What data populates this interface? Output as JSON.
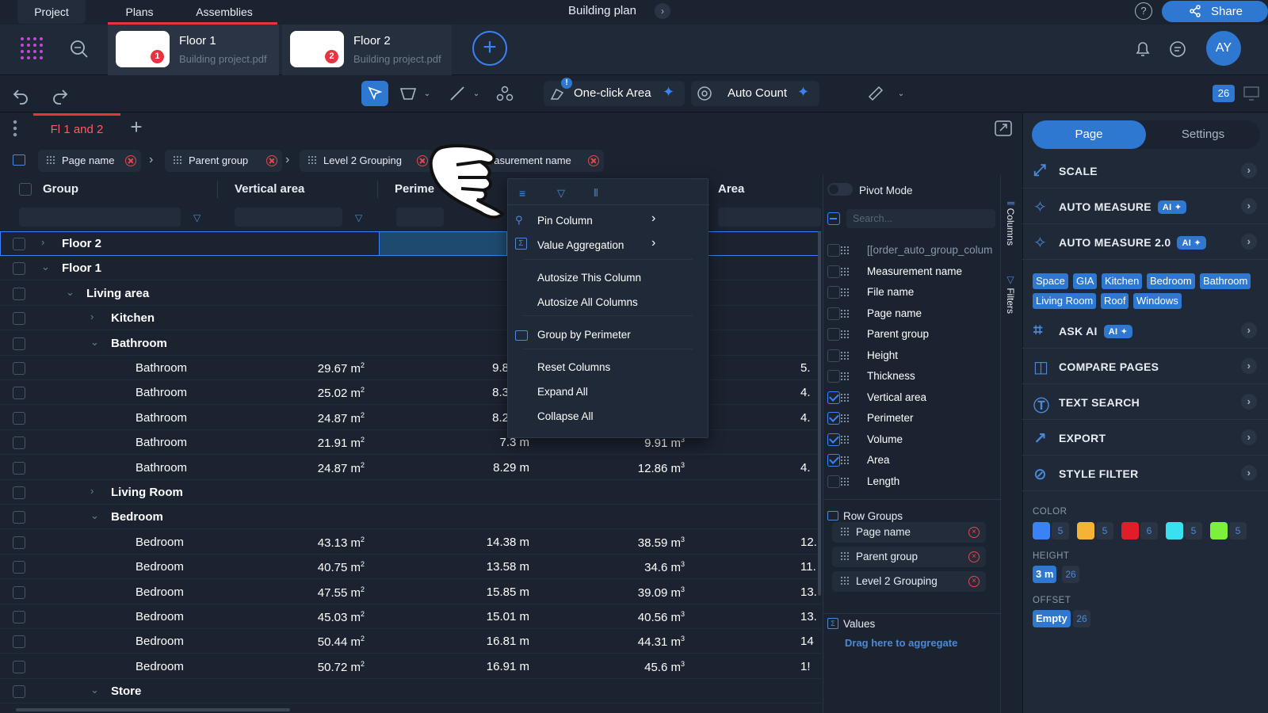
{
  "top": {
    "tabs": [
      "Project",
      "Plans",
      "Assemblies"
    ],
    "doc_title": "Building plan",
    "share": "Share",
    "avatar": "AY"
  },
  "files": [
    {
      "name": "Floor 1",
      "sub": "Building project.pdf",
      "badge": "1"
    },
    {
      "name": "Floor 2",
      "sub": "Building project.pdf",
      "badge": "2"
    }
  ],
  "toolbar": {
    "one_click": "One-click Area",
    "auto_count": "Auto Count",
    "page_count": "26"
  },
  "sheet_tab": "Fl 1 and 2",
  "group_chips": [
    "Page name",
    "Parent group",
    "Level 2 Grouping",
    "easurement name"
  ],
  "grid": {
    "headers": {
      "group": "Group",
      "vertical": "Vertical area",
      "perimeter": "Perime",
      "area": "Area"
    },
    "rows": [
      {
        "label": "Floor 2",
        "v": "",
        "p": "",
        "vol": "",
        "a": ""
      },
      {
        "label": "Floor 1",
        "v": "",
        "p": "",
        "vol": "",
        "a": ""
      },
      {
        "label": "Living area",
        "v": "",
        "p": "",
        "vol": "",
        "a": ""
      },
      {
        "label": "Kitchen",
        "v": "",
        "p": "",
        "vol": "",
        "a": ""
      },
      {
        "label": "Bathroom",
        "v": "",
        "p": "",
        "vol": "",
        "a": ""
      },
      {
        "label": "Bathroom",
        "v": "29.67 m",
        "p": "9.8",
        "vol": "",
        "a": "5."
      },
      {
        "label": "Bathroom",
        "v": "25.02 m",
        "p": "8.3",
        "vol": "",
        "a": "4."
      },
      {
        "label": "Bathroom",
        "v": "24.87 m",
        "p": "8.2",
        "vol": "",
        "a": "4."
      },
      {
        "label": "Bathroom",
        "v": "21.91 m",
        "p": "7.3 m",
        "vol": "9.91 m",
        "a": ""
      },
      {
        "label": "Bathroom",
        "v": "24.87 m",
        "p": "8.29 m",
        "vol": "12.86 m",
        "a": "4."
      },
      {
        "label": "Living Room",
        "v": "",
        "p": "",
        "vol": "",
        "a": ""
      },
      {
        "label": "Bedroom",
        "v": "",
        "p": "",
        "vol": "",
        "a": ""
      },
      {
        "label": "Bedroom",
        "v": "43.13 m",
        "p": "14.38 m",
        "vol": "38.59 m",
        "a": "12."
      },
      {
        "label": "Bedroom",
        "v": "40.75 m",
        "p": "13.58 m",
        "vol": "34.6 m",
        "a": "11."
      },
      {
        "label": "Bedroom",
        "v": "47.55 m",
        "p": "15.85 m",
        "vol": "39.09 m",
        "a": "13."
      },
      {
        "label": "Bedroom",
        "v": "45.03 m",
        "p": "15.01 m",
        "vol": "40.56 m",
        "a": "13."
      },
      {
        "label": "Bedroom",
        "v": "50.44 m",
        "p": "16.81 m",
        "vol": "44.31 m",
        "a": "14"
      },
      {
        "label": "Bedroom",
        "v": "50.72 m",
        "p": "16.91 m",
        "vol": "45.6 m",
        "a": "1!"
      },
      {
        "label": "Store",
        "v": "",
        "p": "",
        "vol": "",
        "a": ""
      }
    ]
  },
  "context_menu": [
    "Pin Column",
    "Value Aggregation",
    "Autosize This Column",
    "Autosize All Columns",
    "Group by Perimeter",
    "Reset Columns",
    "Expand All",
    "Collapse All"
  ],
  "columns_panel": {
    "pivot": "Pivot Mode",
    "search": "Search...",
    "items": [
      {
        "label": "[[order_auto_group_colum",
        "checked": false
      },
      {
        "label": "Measurement name",
        "checked": false
      },
      {
        "label": "File name",
        "checked": false
      },
      {
        "label": "Page name",
        "checked": false
      },
      {
        "label": "Parent group",
        "checked": false
      },
      {
        "label": "Height",
        "checked": false
      },
      {
        "label": "Thickness",
        "checked": false
      },
      {
        "label": "Vertical area",
        "checked": true
      },
      {
        "label": "Perimeter",
        "checked": true
      },
      {
        "label": "Volume",
        "checked": true
      },
      {
        "label": "Area",
        "checked": true
      },
      {
        "label": "Length",
        "checked": false
      }
    ],
    "row_groups_title": "Row Groups",
    "row_groups": [
      "Page name",
      "Parent group",
      "Level 2 Grouping"
    ],
    "values_title": "Values",
    "values_hint": "Drag here to aggregate",
    "side_tabs": [
      "Columns",
      "Filters"
    ]
  },
  "right_panel": {
    "tabs": [
      "Page",
      "Settings"
    ],
    "items": [
      "SCALE",
      "AUTO MEASURE",
      "AUTO MEASURE 2.0",
      "ASK AI",
      "COMPARE PAGES",
      "TEXT SEARCH",
      "EXPORT",
      "STYLE FILTER"
    ],
    "ai_label": "AI",
    "tags": [
      "Space",
      "GIA",
      "Kitchen",
      "Bedroom",
      "Bathroom",
      "Living Room",
      "Roof",
      "Windows"
    ],
    "color_label": "COLOR",
    "colors": [
      {
        "hex": "#3b82f6",
        "count": "5"
      },
      {
        "hex": "#f5b335",
        "count": "5"
      },
      {
        "hex": "#e11d2a",
        "count": "6"
      },
      {
        "hex": "#38e0f0",
        "count": "5"
      },
      {
        "hex": "#7cf03a",
        "count": "5"
      }
    ],
    "height_label": "HEIGHT",
    "height_value": "3 m",
    "height_count": "26",
    "offset_label": "OFFSET",
    "offset_value": "Empty",
    "offset_count": "26"
  }
}
